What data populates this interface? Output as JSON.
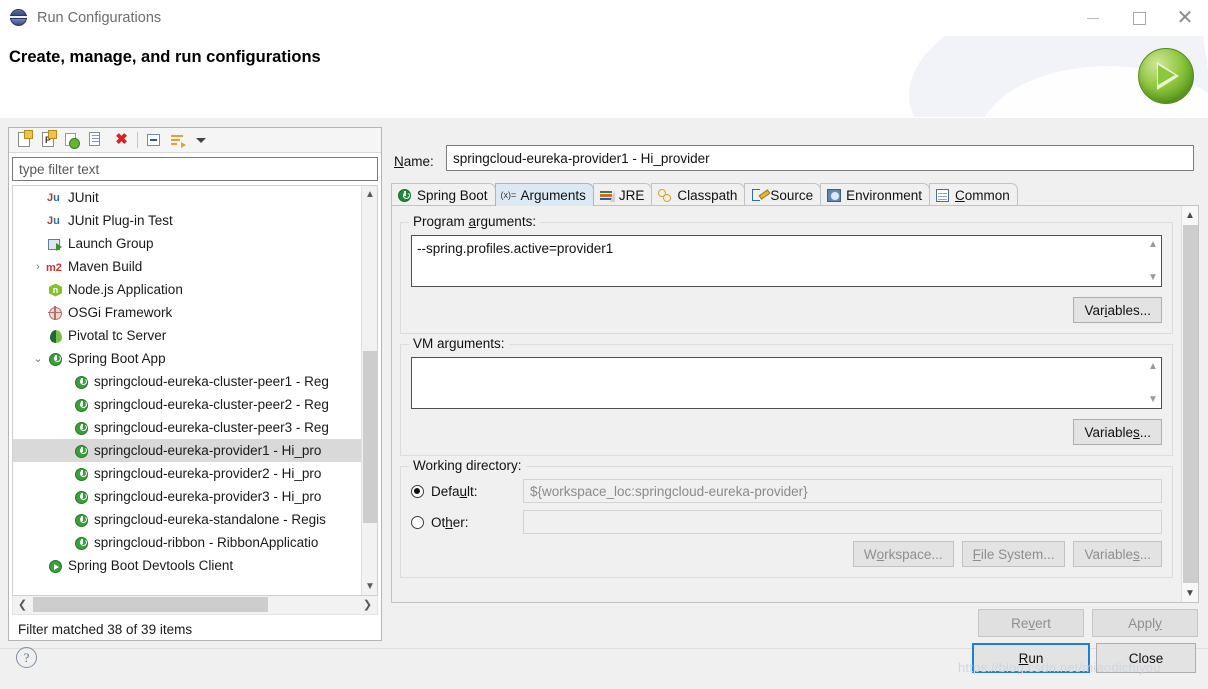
{
  "window": {
    "title": "Run Configurations",
    "icon": "eclipse-sphere-icon",
    "minimize_label": "",
    "maximize_label": "",
    "close_label": "✕"
  },
  "header": {
    "title": "Create, manage, and run configurations",
    "badge_icon": "green-run-play-icon"
  },
  "left_panel": {
    "toolbar": [
      {
        "name": "new-configuration-icon",
        "title": "New launch configuration"
      },
      {
        "name": "new-prototype-icon",
        "title": "New prototype"
      },
      {
        "name": "export-configuration-icon",
        "title": "Export"
      },
      {
        "name": "duplicate-configuration-icon",
        "title": "Duplicate"
      },
      {
        "name": "delete-configuration-icon",
        "title": "Delete"
      },
      {
        "name": "collapse-all-icon",
        "title": "Collapse All"
      },
      {
        "name": "filter-icon",
        "title": "Filter"
      },
      {
        "name": "view-menu-caret-icon",
        "title": "View Menu"
      }
    ],
    "filter": {
      "placeholder": "type filter text",
      "value": ""
    },
    "tree": [
      {
        "label": "JUnit",
        "icon": "junit-icon",
        "level": 1,
        "twisty": "",
        "selected": false
      },
      {
        "label": "JUnit Plug-in Test",
        "icon": "junit-plugin-icon",
        "level": 1,
        "twisty": "",
        "selected": false
      },
      {
        "label": "Launch Group",
        "icon": "launch-group-icon",
        "level": 1,
        "twisty": "",
        "selected": false
      },
      {
        "label": "Maven Build",
        "icon": "maven-icon",
        "level": 1,
        "twisty": "›",
        "selected": false
      },
      {
        "label": "Node.js Application",
        "icon": "nodejs-icon",
        "level": 1,
        "twisty": "",
        "selected": false
      },
      {
        "label": "OSGi Framework",
        "icon": "osgi-icon",
        "level": 1,
        "twisty": "",
        "selected": false
      },
      {
        "label": "Pivotal tc Server",
        "icon": "pivotal-icon",
        "level": 1,
        "twisty": "",
        "selected": false
      },
      {
        "label": "Spring Boot App",
        "icon": "spring-boot-icon",
        "level": 1,
        "twisty": "⌄",
        "selected": false
      },
      {
        "label": "springcloud-eureka-cluster-peer1 - Reg",
        "icon": "spring-boot-icon",
        "level": 2,
        "twisty": "",
        "selected": false
      },
      {
        "label": "springcloud-eureka-cluster-peer2 - Reg",
        "icon": "spring-boot-icon",
        "level": 2,
        "twisty": "",
        "selected": false
      },
      {
        "label": "springcloud-eureka-cluster-peer3 - Reg",
        "icon": "spring-boot-icon",
        "level": 2,
        "twisty": "",
        "selected": false
      },
      {
        "label": "springcloud-eureka-provider1 - Hi_pro",
        "icon": "spring-boot-icon",
        "level": 2,
        "twisty": "",
        "selected": true
      },
      {
        "label": "springcloud-eureka-provider2 - Hi_pro",
        "icon": "spring-boot-icon",
        "level": 2,
        "twisty": "",
        "selected": false
      },
      {
        "label": "springcloud-eureka-provider3 - Hi_pro",
        "icon": "spring-boot-icon",
        "level": 2,
        "twisty": "",
        "selected": false
      },
      {
        "label": "springcloud-eureka-standalone - Regis",
        "icon": "spring-boot-icon",
        "level": 2,
        "twisty": "",
        "selected": false
      },
      {
        "label": "springcloud-ribbon - RibbonApplicatio",
        "icon": "spring-boot-icon",
        "level": 2,
        "twisty": "",
        "selected": false
      },
      {
        "label": "Spring Boot Devtools Client",
        "icon": "devtools-icon",
        "level": 1,
        "twisty": "",
        "selected": false
      }
    ],
    "status": "Filter matched 38 of 39 items"
  },
  "right_panel": {
    "name_label": "Name:",
    "name_label_mnemonic": "N",
    "name_value": "springcloud-eureka-provider1 - Hi_provider",
    "tabs": [
      {
        "label": "Spring Boot",
        "icon": "spring-boot-icon",
        "active": false,
        "mnemonic": ""
      },
      {
        "label": "Arguments",
        "icon": "arguments-icon",
        "active": true,
        "mnemonic": ""
      },
      {
        "label": "JRE",
        "icon": "jre-icon",
        "active": false,
        "mnemonic": ""
      },
      {
        "label": "Classpath",
        "icon": "classpath-icon",
        "active": false,
        "mnemonic": ""
      },
      {
        "label": "Source",
        "icon": "source-icon",
        "active": false,
        "mnemonic": ""
      },
      {
        "label": "Environment",
        "icon": "environment-icon",
        "active": false,
        "mnemonic": ""
      },
      {
        "label": "Common",
        "icon": "common-icon",
        "active": false,
        "mnemonic": "C"
      }
    ],
    "program_arguments": {
      "label": "Program arguments:",
      "label_mnemonic": "a",
      "value": "--spring.profiles.active=provider1",
      "variables_button": "Variables..."
    },
    "vm_arguments": {
      "label": "VM arguments:",
      "value": "",
      "variables_button": "Variables..."
    },
    "working_directory": {
      "label": "Working directory:",
      "default_label": "Default:",
      "default_value": "${workspace_loc:springcloud-eureka-provider}",
      "default_selected": true,
      "other_label": "Other:",
      "other_value": "",
      "other_selected": false,
      "workspace_button": "Workspace...",
      "file_system_button": "File System...",
      "variables_button": "Variables..."
    },
    "revert_button": "Revert",
    "apply_button": "Apply"
  },
  "footer": {
    "help_icon": "help-question-icon",
    "run_button": "Run",
    "close_button": "Close",
    "watermark": "https://blog.csdn.net/miaodichiyou"
  }
}
